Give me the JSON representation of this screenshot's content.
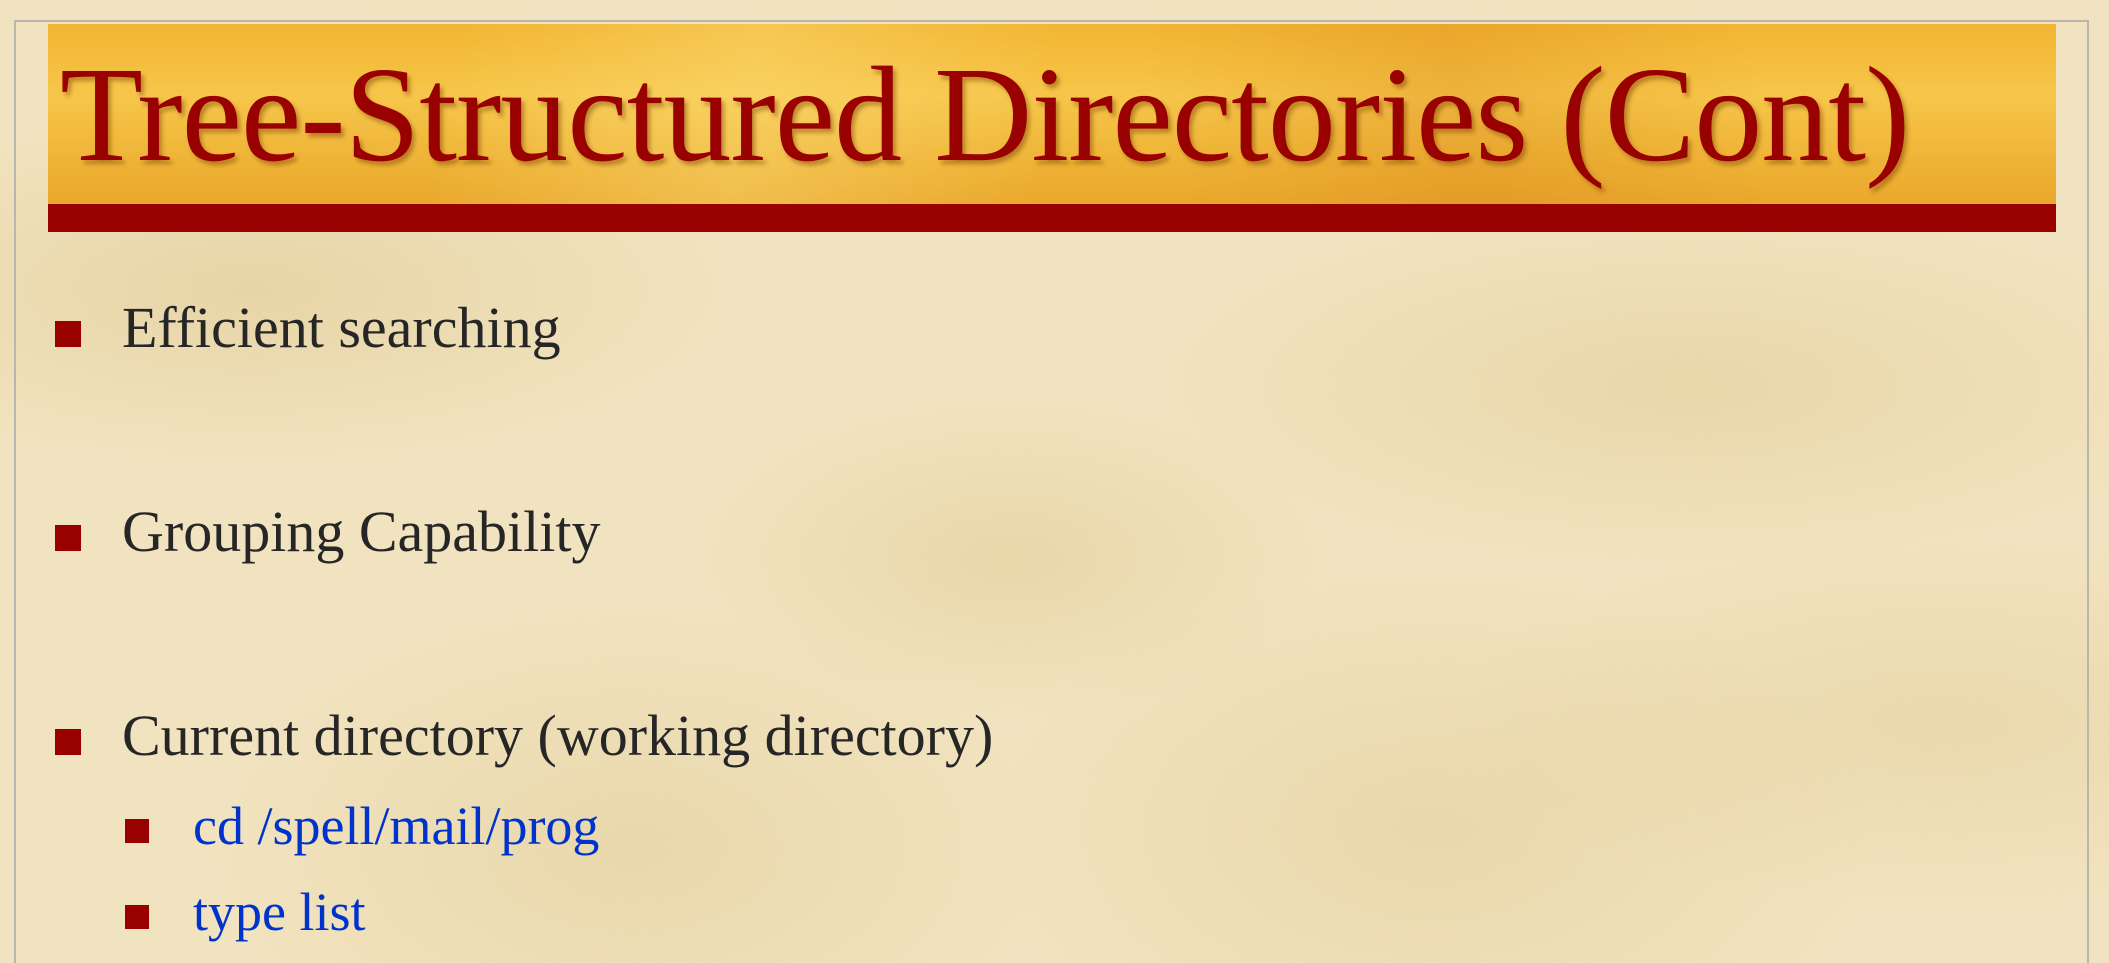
{
  "slide": {
    "title": "Tree-Structured Directories (Cont)",
    "bullets": [
      {
        "text": "Efficient searching",
        "level": 1
      },
      {
        "text": "Grouping Capability",
        "level": 1
      },
      {
        "text": "Current directory (working directory)",
        "level": 1
      },
      {
        "text": "cd /spell/mail/prog",
        "level": 2
      },
      {
        "text": "type list",
        "level": 2
      }
    ]
  },
  "colors": {
    "accent": "#990000",
    "banner": "#f6c64a",
    "background": "#f1e3bf",
    "body_text": "#262626",
    "sub_text": "#0033cc"
  }
}
